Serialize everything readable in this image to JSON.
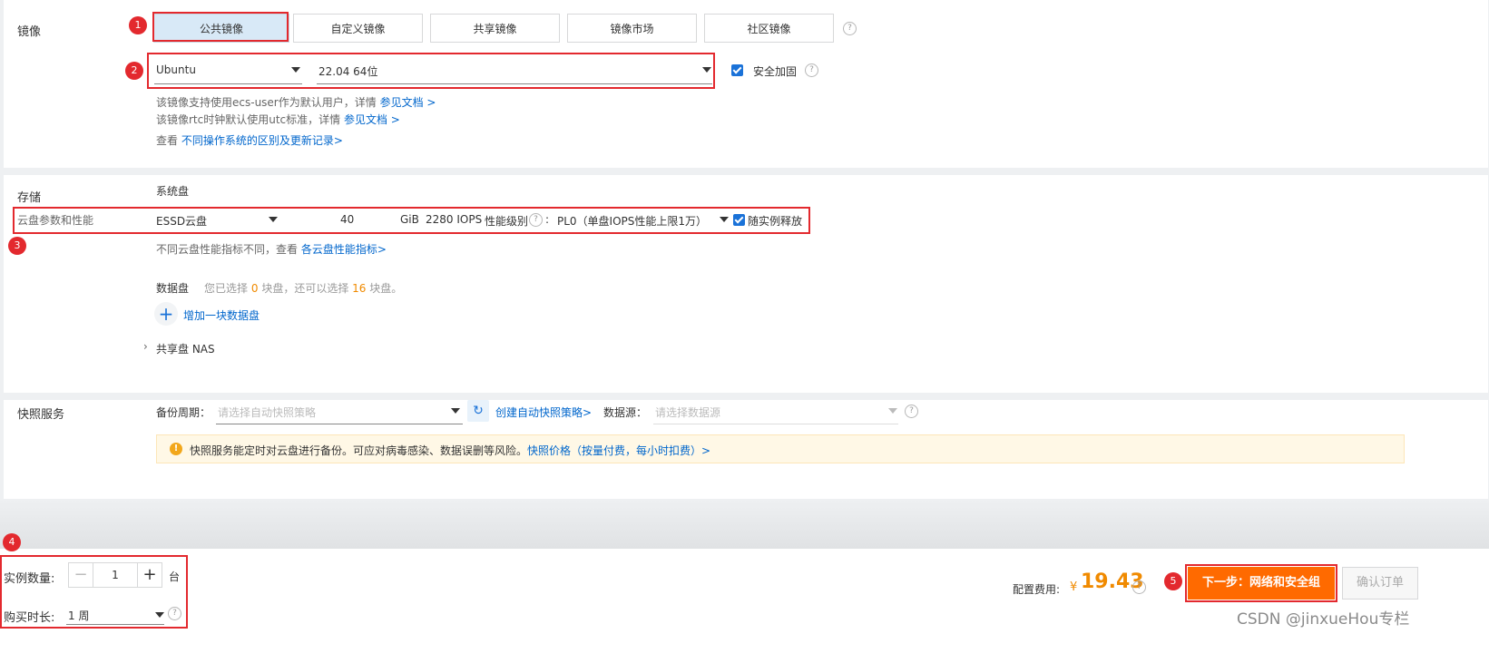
{
  "image": {
    "label": "镜像",
    "tabs": [
      "公共镜像",
      "自定义镜像",
      "共享镜像",
      "镜像市场",
      "社区镜像"
    ],
    "os": "Ubuntu",
    "version": "22.04 64位",
    "security_label": "安全加固",
    "note1_text": "该镜像支持使用ecs-user作为默认用户，详情",
    "note1_link": "参见文档 >",
    "note2_text": "该镜像rtc时钟默认使用utc标准，详情",
    "note2_link": "参见文档 >",
    "note3_text": "查看",
    "note3_link": "不同操作系统的区别及更新记录>"
  },
  "storage": {
    "label": "存储",
    "sub_label": "云盘参数和性能",
    "system_disk_label": "系统盘",
    "disk_type": "ESSD云盘",
    "size": "40",
    "unit": "GiB",
    "iops": "2280 IOPS",
    "perf_label": "性能级别",
    "perf_colon": ":",
    "perf_value": "PL0（单盘IOPS性能上限1万）",
    "release_label": "随实例释放",
    "perf_note": "不同云盘性能指标不同，查看",
    "perf_link": "各云盘性能指标>",
    "data_disk_label": "数据盘",
    "data_disk_pre": "您已选择",
    "data_disk_selected": "0",
    "data_disk_mid": "块盘，还可以选择",
    "data_disk_remaining": "16",
    "data_disk_post": "块盘。",
    "add_disk": "增加一块数据盘",
    "nas": "共享盘 NAS"
  },
  "snapshot": {
    "label": "快照服务",
    "period_label": "备份周期：",
    "period_placeholder": "请选择自动快照策略",
    "create_link": "创建自动快照策略>",
    "source_label": "数据源：",
    "source_placeholder": "请选择数据源",
    "notice_text": "快照服务能定时对云盘进行备份。可应对病毒感染、数据误删等风险。",
    "notice_link": "快照价格（按量付费，每小时扣费）>"
  },
  "footer": {
    "qty_label": "实例数量:",
    "qty_value": "1",
    "qty_unit": "台",
    "duration_label": "购买时长:",
    "duration_value": "1 周",
    "fee_label": "配置费用:",
    "fee_currency": "¥",
    "fee_value": "19.43",
    "next_button": "下一步：网络和安全组",
    "confirm_button": "确认订单"
  },
  "badges": [
    "1",
    "2",
    "3",
    "4",
    "5"
  ],
  "watermark": "CSDN @jinxueHou专栏",
  "colors": {
    "accent": "#ff6a00",
    "link": "#0066cc",
    "highlight": "#e3292e",
    "price": "#f08a00"
  }
}
